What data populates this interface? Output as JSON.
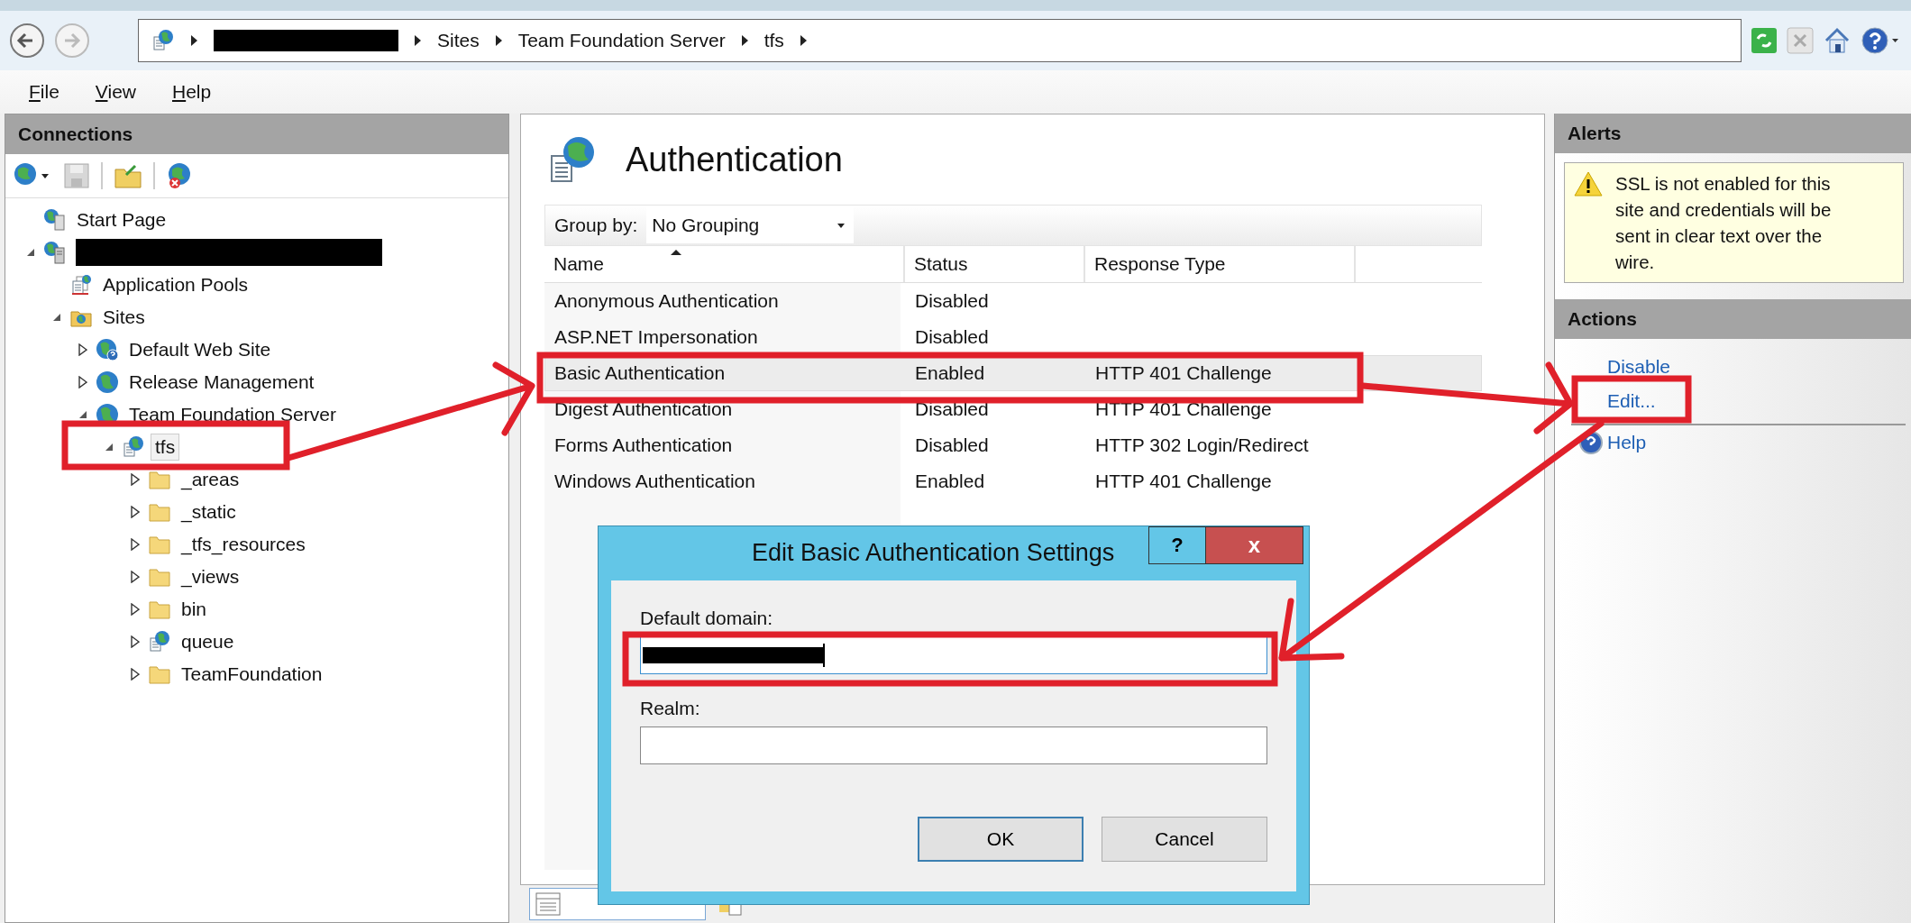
{
  "address_bar": {
    "segments": [
      {
        "kind": "redacted"
      },
      {
        "kind": "text",
        "label": "Sites"
      },
      {
        "kind": "text",
        "label": "Team Foundation Server"
      },
      {
        "kind": "text",
        "label": "tfs"
      }
    ]
  },
  "menu": [
    "File",
    "View",
    "Help"
  ],
  "connections": {
    "title": "Connections",
    "tree": [
      {
        "label": "Start Page",
        "kind": "start",
        "selected": false
      },
      {
        "kind": "server",
        "expanded": true,
        "selected": false,
        "children": [
          {
            "label": "Application Pools",
            "kind": "pools",
            "selected": false
          },
          {
            "label": "Sites",
            "kind": "sites",
            "expanded": true,
            "selected": false,
            "children": [
              {
                "label": "Default Web Site",
                "kind": "globe-help",
                "expanded": false,
                "selected": false
              },
              {
                "label": "Release Management",
                "kind": "globe",
                "expanded": false,
                "selected": false
              },
              {
                "label": "Team Foundation Server",
                "kind": "globe",
                "expanded": true,
                "selected": false,
                "children": [
                  {
                    "label": "tfs",
                    "kind": "app",
                    "expanded": true,
                    "selected": true,
                    "children": [
                      {
                        "label": "_areas",
                        "kind": "folder",
                        "expanded": false,
                        "selected": false
                      },
                      {
                        "label": "_static",
                        "kind": "folder",
                        "expanded": false,
                        "selected": false
                      },
                      {
                        "label": "_tfs_resources",
                        "kind": "folder",
                        "expanded": false,
                        "selected": false
                      },
                      {
                        "label": "_views",
                        "kind": "folder",
                        "expanded": false,
                        "selected": false
                      },
                      {
                        "label": "bin",
                        "kind": "folder",
                        "expanded": false,
                        "selected": false
                      },
                      {
                        "label": "queue",
                        "kind": "app",
                        "expanded": false,
                        "selected": false
                      },
                      {
                        "label": "TeamFoundation",
                        "kind": "folder",
                        "expanded": false,
                        "selected": false
                      }
                    ]
                  }
                ]
              }
            ]
          }
        ]
      }
    ]
  },
  "feature": {
    "title": "Authentication",
    "group_by": {
      "label": "Group by:",
      "value": "No Grouping"
    },
    "columns": [
      {
        "label": "Name",
        "sorted": true
      },
      {
        "label": "Status",
        "sorted": false
      },
      {
        "label": "Response Type",
        "sorted": false
      }
    ],
    "rows": [
      {
        "name": "Anonymous Authentication",
        "status": "Disabled",
        "selected": false
      },
      {
        "name": "ASP.NET Impersonation",
        "status": "Disabled",
        "selected": false
      },
      {
        "name": "Basic Authentication",
        "status": "Enabled",
        "response": "HTTP 401 Challenge",
        "selected": true
      },
      {
        "name": "Digest Authentication",
        "status": "Disabled",
        "response": "HTTP 401 Challenge",
        "selected": false
      },
      {
        "name": "Forms Authentication",
        "status": "Disabled",
        "response": "HTTP 302 Login/Redirect",
        "selected": false
      },
      {
        "name": "Windows Authentication",
        "status": "Enabled",
        "response": "HTTP 401 Challenge",
        "selected": false
      }
    ]
  },
  "view_tabs": [
    {
      "kind": "features",
      "selected": true
    },
    {
      "kind": "content",
      "selected": false
    }
  ],
  "alerts": {
    "title": "Alerts",
    "message": "SSL is not enabled for this site and credentials will be sent in clear text over the wire."
  },
  "actions": {
    "title": "Actions",
    "items": [
      {
        "label": "Disable",
        "kind": "link",
        "separator_before": false
      },
      {
        "label": "Edit...",
        "kind": "link",
        "separator_before": false
      },
      {
        "label": "Help",
        "kind": "help",
        "separator_before": true
      }
    ]
  },
  "dialog": {
    "title": "Edit Basic Authentication Settings",
    "help_button": "?",
    "close_button": "x",
    "fields": [
      {
        "label": "Default domain:",
        "redacted": true,
        "focused": true
      },
      {
        "label": "Realm:",
        "focused": false
      }
    ],
    "buttons": [
      {
        "label": "OK",
        "default": true
      },
      {
        "label": "Cancel",
        "default": false
      }
    ]
  }
}
